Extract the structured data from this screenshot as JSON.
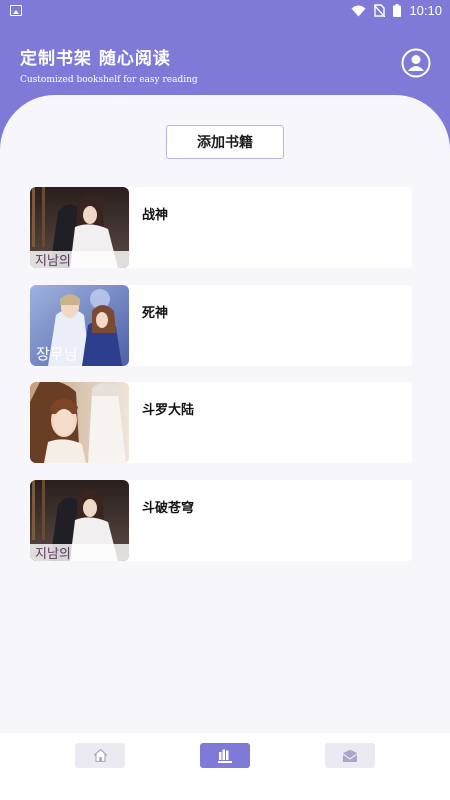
{
  "status_bar": {
    "time": "10:10"
  },
  "header": {
    "title": "定制书架 随心阅读",
    "subtitle": "Customized bookshelf for easy reading"
  },
  "actions": {
    "add_book": "添加书籍"
  },
  "books": [
    {
      "title": "战神",
      "cover_text": "지남의"
    },
    {
      "title": "死神",
      "cover_text": "장무님"
    },
    {
      "title": "斗罗大陆",
      "cover_text": ""
    },
    {
      "title": "斗破苍穹",
      "cover_text": "지남의"
    }
  ],
  "bottom_nav": {
    "items": [
      {
        "icon": "home-icon",
        "active": false
      },
      {
        "icon": "bookshelf-icon",
        "active": true
      },
      {
        "icon": "mail-icon",
        "active": false
      }
    ]
  },
  "colors": {
    "accent": "#7f7ad8",
    "background": "#f6f6fb",
    "nav_inactive": "#ebeaf3"
  }
}
